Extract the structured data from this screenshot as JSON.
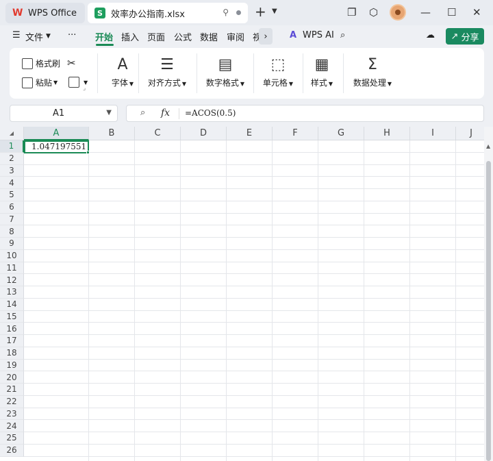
{
  "titlebar": {
    "home_tab": "WPS Office",
    "doc_tab": "效率办公指南.xlsx",
    "doc_tab_badge": "S"
  },
  "menubar": {
    "file": "文件",
    "more": "···",
    "tabs": [
      "开始",
      "插入",
      "页面",
      "公式",
      "数据",
      "审阅",
      "视"
    ],
    "ai": "WPS AI",
    "share": "分享"
  },
  "ribbon": {
    "format_painter": "格式刷",
    "paste": "粘贴",
    "font": "字体",
    "align": "对齐方式",
    "number_format": "数字格式",
    "cells": "单元格",
    "style": "样式",
    "data_processing": "数据处理"
  },
  "formula_bar": {
    "name_box": "A1",
    "formula": "=ACOS(0.5)"
  },
  "sheet": {
    "columns": [
      "A",
      "B",
      "C",
      "D",
      "E",
      "F",
      "G",
      "H",
      "I",
      "J"
    ],
    "rows": [
      "1",
      "2",
      "3",
      "4",
      "5",
      "6",
      "7",
      "8",
      "9",
      "10",
      "11",
      "12",
      "13",
      "14",
      "15",
      "16",
      "17",
      "18",
      "19",
      "20",
      "21",
      "22",
      "23",
      "24",
      "25",
      "26"
    ],
    "a1_value": "1.047197551"
  },
  "colors": {
    "accent": "#1a8a55",
    "share_button": "#1a8a60",
    "sheet_badge": "#1e9e5e",
    "wps_logo": "#e23a2e"
  }
}
